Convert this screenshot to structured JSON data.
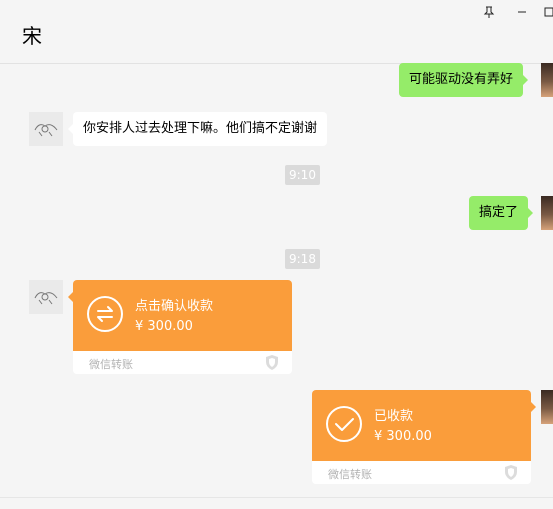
{
  "header": {
    "title": "宋",
    "pin_glyph": "⊤",
    "min_glyph": "—",
    "max_glyph": "□"
  },
  "messages": {
    "out1": "可能驱动没有弄好",
    "in1": "你安排人过去处理下嘛。他们搞不定谢谢",
    "time1": "9:10",
    "out2": "搞定了",
    "time2": "9:18"
  },
  "transfer_in": {
    "status": "点击确认收款",
    "amount": "¥ 300.00",
    "brand": "微信转账",
    "icon": "transfer-arrows-icon"
  },
  "transfer_out": {
    "status": "已收款",
    "amount": "¥ 300.00",
    "brand": "微信转账",
    "icon": "check-icon"
  },
  "colors": {
    "outgoing_bubble": "#95ec69",
    "incoming_bubble": "#ffffff",
    "transfer": "#fa9d3b",
    "background": "#f5f5f5",
    "timestamp_bg": "#dadada"
  }
}
